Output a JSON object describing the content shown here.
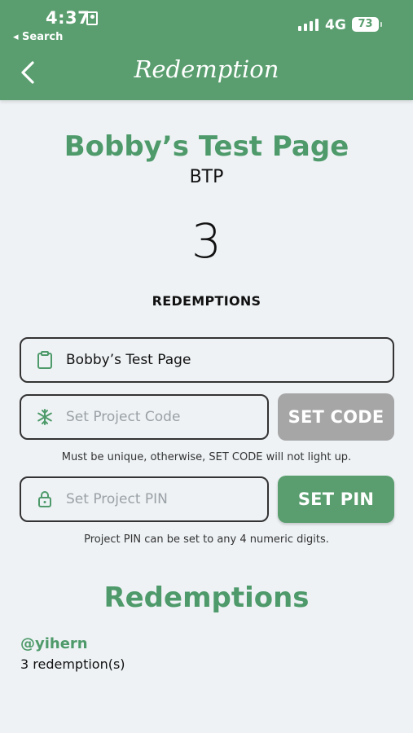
{
  "status_bar": {
    "time": "4:37",
    "back_app": "◂ Search",
    "network": "4G",
    "battery": "73"
  },
  "nav": {
    "title": "Redemption"
  },
  "project": {
    "name": "Bobby’s Test Page",
    "short_code": "BTP",
    "redemption_count": "3",
    "count_label": "REDEMPTIONS"
  },
  "fields": {
    "project_name_value": "Bobby’s Test Page",
    "project_code_placeholder": "Set Project Code",
    "project_pin_placeholder": "Set Project PIN"
  },
  "buttons": {
    "set_code": "SET CODE",
    "set_pin": "SET PIN"
  },
  "hints": {
    "code_hint": "Must be unique, otherwise, SET CODE will not light up.",
    "pin_hint": "Project PIN can be set to any 4 numeric digits."
  },
  "redemptions": {
    "title": "Redemptions",
    "items": [
      {
        "user": "@yihern",
        "count_text": "3 redemption(s)"
      }
    ]
  },
  "colors": {
    "brand_green": "#5a9e6f",
    "title_green": "#4e9a6a",
    "disabled_gray": "#a6a6a6",
    "background": "#eef2f5"
  },
  "icons": {
    "status_lock": "lock-icon",
    "signal": "signal-icon",
    "battery": "battery-icon",
    "back": "chevron-left-icon",
    "project_name": "clipboard-icon",
    "project_code": "snowflake-icon",
    "project_pin": "padlock-icon"
  }
}
